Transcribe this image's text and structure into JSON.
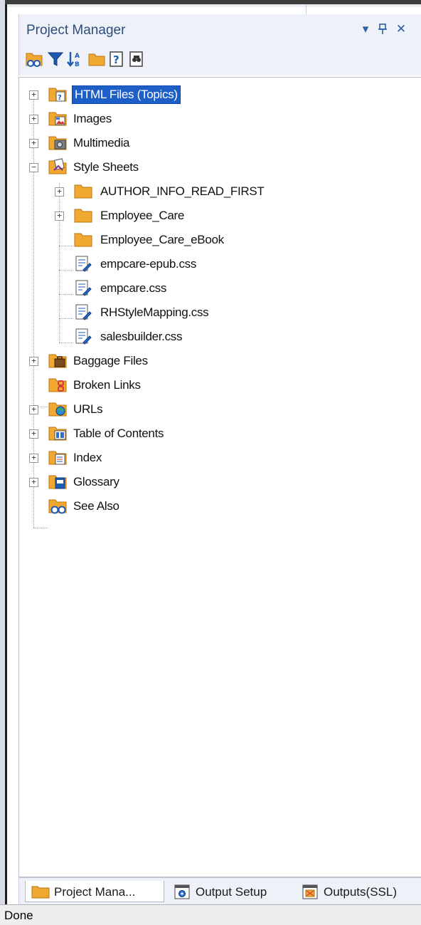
{
  "panel": {
    "title": "Project Manager",
    "dropdown_glyph": "▾",
    "pin_glyph": "ᵖ",
    "close_glyph": "✕"
  },
  "toolbar": {
    "buttons": [
      {
        "name": "new-folder-view-icon"
      },
      {
        "name": "filter-icon"
      },
      {
        "name": "sort-az-icon"
      },
      {
        "name": "folder-icon"
      },
      {
        "name": "help-topic-icon"
      },
      {
        "name": "find-icon"
      }
    ]
  },
  "tree": {
    "nodes": [
      {
        "label": "HTML Files (Topics)",
        "icon": "html-topics-folder-icon",
        "expander": "+",
        "selected": true
      },
      {
        "label": "Images",
        "icon": "images-folder-icon",
        "expander": "+"
      },
      {
        "label": "Multimedia",
        "icon": "multimedia-folder-icon",
        "expander": "+"
      },
      {
        "label": "Style Sheets",
        "icon": "style-sheets-folder-icon",
        "expander": "−"
      },
      {
        "label": "AUTHOR_INFO_READ_FIRST",
        "icon": "folder-icon",
        "expander": "+"
      },
      {
        "label": "Employee_Care",
        "icon": "folder-icon",
        "expander": "+"
      },
      {
        "label": "Employee_Care_eBook",
        "icon": "folder-icon"
      },
      {
        "label": "empcare-epub.css",
        "icon": "css-file-icon"
      },
      {
        "label": "empcare.css",
        "icon": "css-file-icon"
      },
      {
        "label": "RHStyleMapping.css",
        "icon": "css-file-icon"
      },
      {
        "label": "salesbuilder.css",
        "icon": "css-file-icon"
      },
      {
        "label": "Baggage Files",
        "icon": "baggage-folder-icon",
        "expander": "+"
      },
      {
        "label": "Broken Links",
        "icon": "broken-links-folder-icon"
      },
      {
        "label": "URLs",
        "icon": "urls-folder-icon",
        "expander": "+"
      },
      {
        "label": "Table of Contents",
        "icon": "toc-folder-icon",
        "expander": "+"
      },
      {
        "label": "Index",
        "icon": "index-folder-icon",
        "expander": "+"
      },
      {
        "label": "Glossary",
        "icon": "glossary-folder-icon",
        "expander": "+"
      },
      {
        "label": "See Also",
        "icon": "see-also-folder-icon"
      }
    ]
  },
  "tabs": [
    {
      "label": "Project Mana...",
      "icon": "folder-icon",
      "active": true
    },
    {
      "label": "Output Setup",
      "icon": "output-setup-icon"
    },
    {
      "label": "Outputs(SSL)",
      "icon": "outputs-ssl-icon"
    }
  ],
  "status": {
    "text": "Done"
  },
  "colors": {
    "selection": "#1e5fc7",
    "folder": "#f0a830",
    "title_text": "#2d4d7a"
  }
}
